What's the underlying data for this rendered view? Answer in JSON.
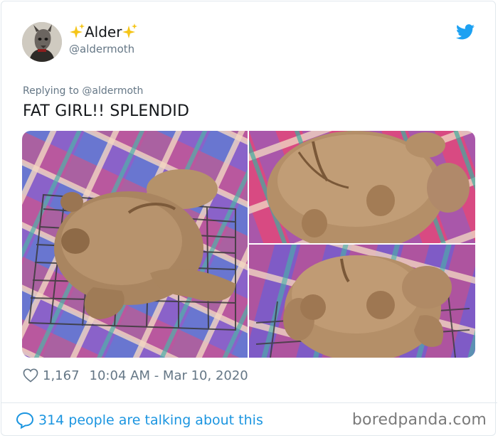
{
  "user": {
    "name": "Alder",
    "handle": "@aldermoth"
  },
  "tweet": {
    "replying_to": "Replying to @aldermoth",
    "text": "FAT GIRL!! SPLENDID",
    "likes": "1,167",
    "timestamp": "10:04 AM - Mar 10, 2020"
  },
  "footer": {
    "conversation": "314 people are talking about this",
    "watermark": "boredpanda.com"
  },
  "colors": {
    "link_blue": "#1b95e0",
    "twitter_blue": "#1da1f2",
    "muted": "#657786"
  },
  "media": {
    "photos": [
      {
        "subject": "frog-shaped bread loaf on cooling rack, side view"
      },
      {
        "subject": "frog-shaped bread loaf, top view"
      },
      {
        "subject": "frog-shaped bread loaf, front view"
      }
    ]
  }
}
